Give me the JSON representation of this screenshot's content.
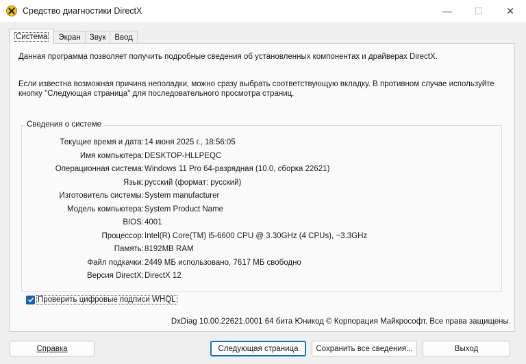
{
  "window": {
    "title": "Средство диагностики DirectX",
    "minimize_glyph": "—",
    "maximize_glyph": "☐",
    "close_glyph": "✕"
  },
  "tabs": [
    {
      "label": "Система",
      "active": true
    },
    {
      "label": "Экран",
      "active": false
    },
    {
      "label": "Звук",
      "active": false
    },
    {
      "label": "Ввод",
      "active": false
    }
  ],
  "intro": {
    "line1": "Данная программа позволяет получить подробные сведения об установленных компонентах и драйверах DirectX.",
    "line2": "Если известна возможная причина неполадки, можно сразу выбрать соответствующую вкладку. В противном случае используйте кнопку \"Следующая страница\" для последовательного просмотра страниц."
  },
  "system_info": {
    "title": "Сведения о системе",
    "rows": [
      {
        "label": "Текущие время и дата:",
        "value": "14 июня 2025 г., 18:56:05"
      },
      {
        "label": "Имя компьютера:",
        "value": "DESKTOP-HLLPEQC"
      },
      {
        "label": "Операционная система:",
        "value": "Windows 11 Pro 64-разрядная (10.0, сборка 22621)"
      },
      {
        "label": "Язык:",
        "value": "русский (формат: русский)"
      },
      {
        "label": "Изготовитель системы:",
        "value": "System manufacturer"
      },
      {
        "label": "Модель компьютера:",
        "value": "System Product Name"
      },
      {
        "label": "BIOS:",
        "value": "4001"
      },
      {
        "label": "Процессор:",
        "value": "Intel(R) Core(TM) i5-6600 CPU @ 3.30GHz (4 CPUs), ~3.3GHz"
      },
      {
        "label": "Память:",
        "value": "8192MB RAM"
      },
      {
        "label": "Файл подкачки:",
        "value": "2449 МБ использовано, 7617 МБ свободно"
      },
      {
        "label": "Версия DirectX:",
        "value": "DirectX 12"
      }
    ]
  },
  "whql_checkbox": {
    "label": "Проверить цифровые подписи WHQL",
    "checked": true
  },
  "footer": "DxDiag 10.00.22621.0001 64 бита Юникод © Корпорация Майкрософт. Все права защищены.",
  "buttons": {
    "help": "Справка",
    "next": "Следующая страница",
    "save": "Сохранить все сведения...",
    "exit": "Выход"
  },
  "colors": {
    "accent": "#1a6fc4",
    "checkbox": "#1a5fb4"
  }
}
